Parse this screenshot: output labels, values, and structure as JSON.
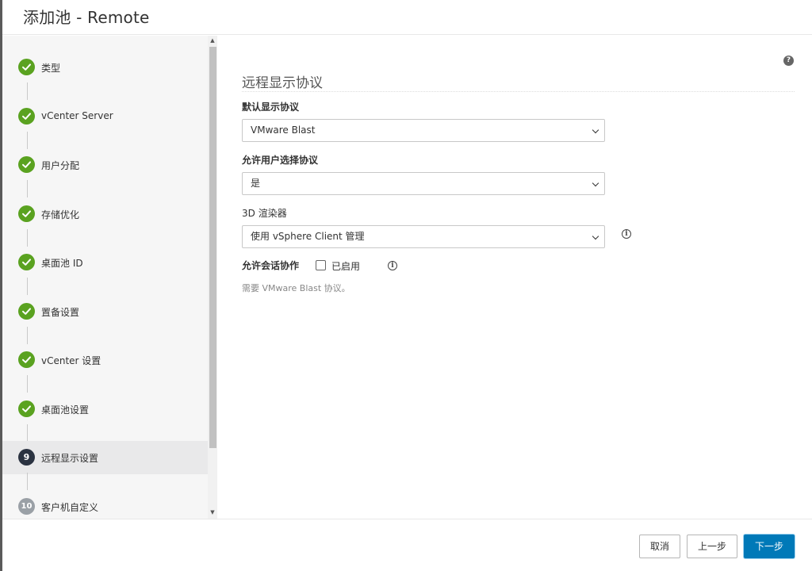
{
  "window": {
    "title": "添加池 - Remote"
  },
  "steps": [
    {
      "number": "1",
      "label": "类型",
      "status": "done"
    },
    {
      "number": "2",
      "label": "vCenter Server",
      "status": "done"
    },
    {
      "number": "3",
      "label": "用户分配",
      "status": "done"
    },
    {
      "number": "4",
      "label": "存储优化",
      "status": "done"
    },
    {
      "number": "5",
      "label": "桌面池 ID",
      "status": "done"
    },
    {
      "number": "6",
      "label": "置备设置",
      "status": "done"
    },
    {
      "number": "7",
      "label": "vCenter 设置",
      "status": "done"
    },
    {
      "number": "8",
      "label": "桌面池设置",
      "status": "done"
    },
    {
      "number": "9",
      "label": "远程显示设置",
      "status": "current"
    },
    {
      "number": "10",
      "label": "客户机自定义",
      "status": "future"
    }
  ],
  "main": {
    "section_title": "远程显示协议",
    "default_protocol": {
      "label": "默认显示协议",
      "value": "VMware Blast"
    },
    "allow_user_choose": {
      "label": "允许用户选择协议",
      "value": "是"
    },
    "renderer_3d": {
      "label": "3D 渲染器",
      "value": "使用 vSphere Client 管理"
    },
    "session_collab": {
      "label": "允许会话协作",
      "checkbox_label": "已启用",
      "checked": false
    },
    "hint": "需要 VMware Blast 协议。"
  },
  "footer": {
    "cancel_label": "取消",
    "back_label": "上一步",
    "next_label": "下一步"
  },
  "colors": {
    "done": "#5aa220",
    "current": "#2b3341",
    "future": "#9aa0a6",
    "primary": "#0079b8"
  },
  "icons": {
    "done": "checkmark-icon",
    "help": "help-icon",
    "info": "info-icon",
    "chevron": "chevron-down-icon"
  }
}
